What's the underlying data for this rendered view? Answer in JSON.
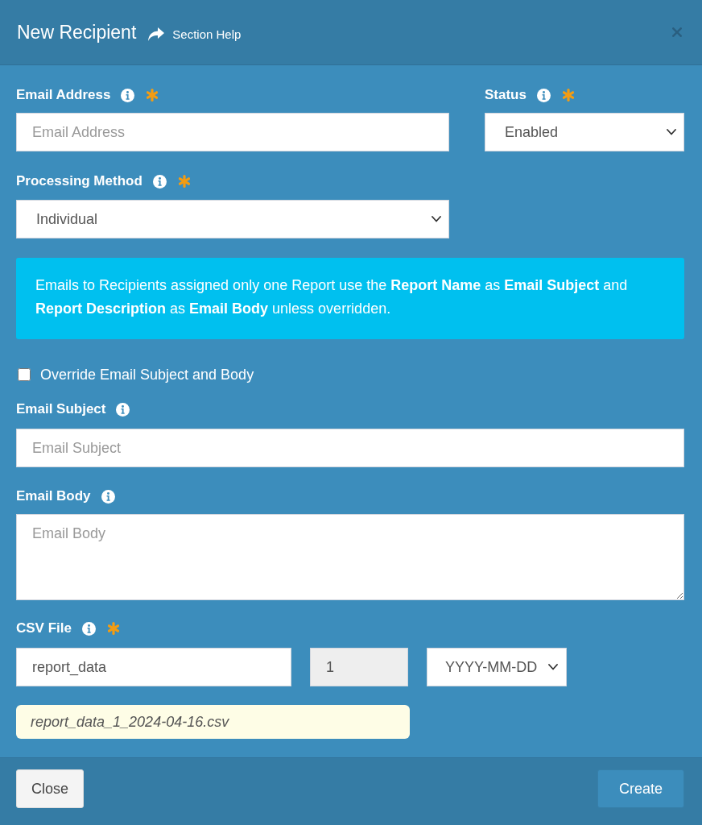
{
  "dialog": {
    "title": "New Recipient",
    "help_link": "Section Help"
  },
  "form": {
    "email_address": {
      "label": "Email Address",
      "required": true,
      "placeholder": "Email Address"
    },
    "status": {
      "label": "Status",
      "required": true,
      "value": "Enabled"
    },
    "processing_method": {
      "label": "Processing Method",
      "required": true,
      "value": "Individual"
    },
    "notice": "Emails to Recipients assigned only one Report use the **Report Name** as **Email Subject** and **Report Description** as **Email Body** unless overridden.",
    "override": {
      "label": "Override Email Subject and Body",
      "checked": false
    },
    "email_subject": {
      "label": "Email Subject",
      "required": false,
      "placeholder": "Email Subject"
    },
    "email_body": {
      "label": "Email Body",
      "required": false,
      "placeholder": "Email Body"
    },
    "csv_file": {
      "label": "CSV File",
      "required": true,
      "name": {
        "value": "report_data"
      },
      "sequence": {
        "value": "1",
        "readonly": true
      },
      "date_format": {
        "value": "YYYY-MM-DD"
      },
      "preview": "report_data_1_2024-04-16.csv"
    }
  },
  "footer": {
    "buttons": [
      {
        "label": "Close",
        "kind": "dismiss"
      },
      {
        "label": "Create",
        "kind": "submit"
      }
    ]
  }
}
